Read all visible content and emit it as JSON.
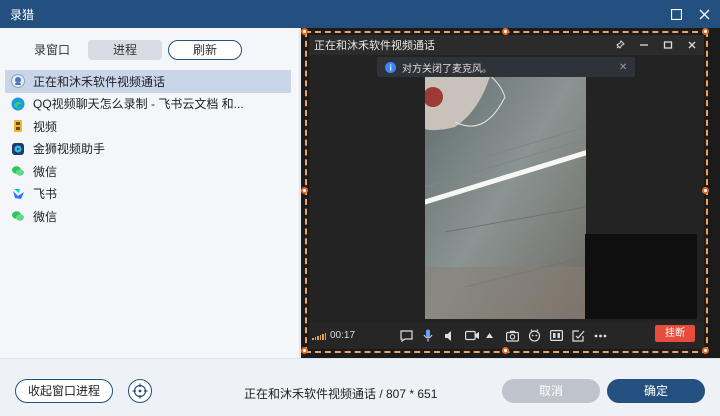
{
  "window": {
    "title": "录猎"
  },
  "left": {
    "tabs": {
      "window": "录窗口",
      "process": "进程",
      "refresh": "刷新"
    },
    "items": [
      {
        "label": "正在和沐禾软件视频通话",
        "icon": "qq-icon",
        "selected": true
      },
      {
        "label": "QQ视频聊天怎么录制 - 飞书云文档 和...",
        "icon": "edge-icon",
        "selected": false
      },
      {
        "label": "视频",
        "icon": "video-app-icon",
        "selected": false
      },
      {
        "label": "金狮视频助手",
        "icon": "lion-app-icon",
        "selected": false
      },
      {
        "label": "微信",
        "icon": "wechat-icon",
        "selected": false
      },
      {
        "label": "飞书",
        "icon": "feishu-icon",
        "selected": false
      },
      {
        "label": "微信",
        "icon": "wechat-icon",
        "selected": false
      }
    ]
  },
  "preview": {
    "video_window_title": "正在和沐禾软件视频通话",
    "notice": "对方关闭了麦克风。",
    "time": "00:17",
    "hangup": "挂断"
  },
  "bottom": {
    "collapse_label": "收起窗口进程",
    "info": "正在和沐禾软件视频通话 / 807 * 651",
    "cancel_label": "取消",
    "ok_label": "确定"
  },
  "colors": {
    "brand": "#24507f",
    "frame": "#e46b1f",
    "hangup": "#e74c3c"
  }
}
